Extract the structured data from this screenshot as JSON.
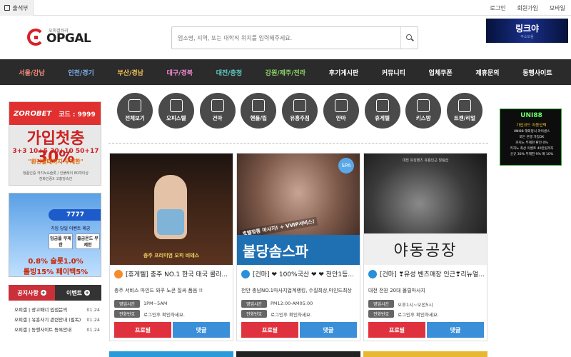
{
  "topbar": {
    "attend_label": "출석부",
    "links": [
      "로그인",
      "회원가입",
      "모바일"
    ]
  },
  "header": {
    "logo_sub": "오피갤러리",
    "logo_text": "OPGAL",
    "search_placeholder": "업소명, 지역, 또는 대학직 위치를 입력해주세요.",
    "banner_main": "링크야",
    "banner_sub": "주소모음"
  },
  "nav": {
    "items": [
      {
        "label": "서울/강남",
        "color": "#f48b7c"
      },
      {
        "label": "인천/경기",
        "color": "#7fb0f0"
      },
      {
        "label": "부산/경남",
        "color": "#f6c45a"
      },
      {
        "label": "대구/경북",
        "color": "#f48bd4"
      },
      {
        "label": "대전/충청",
        "color": "#5fd0c8"
      },
      {
        "label": "강원/제주/전라",
        "color": "#8fd86a"
      },
      {
        "label": "후기게시판",
        "color": "#ffffff"
      },
      {
        "label": "커뮤니티",
        "color": "#ffffff"
      },
      {
        "label": "업체쿠폰",
        "color": "#ffffff"
      },
      {
        "label": "제휴문의",
        "color": "#ffffff"
      },
      {
        "label": "동행사이트",
        "color": "#ffffff"
      }
    ]
  },
  "left_banner1": {
    "brand": "ZOROBET",
    "code": "코드 : 9999",
    "headline": "가입첫충 30%",
    "rates": "3+3 10+5 30+10 50+17",
    "sub": "\"환전할때까지 무제한\"",
    "foot1": "정품인증 카지노&슬롯 / 인플레이 80개이상",
    "foot2": "전화인증X 고충당속인"
  },
  "left_banner2": {
    "pill": "7777",
    "text": "가입 당일 이벤트 제공",
    "box1": "입금플 무제한",
    "box2": "출금온드 무제한",
    "line1": "0.8% 슬롯1.0%",
    "line2": "롤빙15% 페이백5%"
  },
  "notice": {
    "tab1": "공지사항",
    "tab2": "이벤트",
    "items": [
      {
        "title": "오피갤 | 광고배너 입점문의",
        "date": "01.24"
      },
      {
        "title": "오피갤 | 유흥사기 관련안내 (필독)",
        "date": "01.24"
      },
      {
        "title": "오피갤 | 동행사이트 등록안내",
        "date": "01.24"
      }
    ]
  },
  "categories": [
    "전체보기",
    "오피스텔",
    "건마",
    "핸플/립",
    "유흥주점",
    "안마",
    "휴게텔",
    "키스방",
    "트젠/리얼"
  ],
  "cards": [
    {
      "title": "[휴게텔] 충주 NO.1 한국 태국 콜라...",
      "desc": "충주 서비스 마인드 와꾸 노콘 질싸 품음 !!",
      "hours_label": "영업시간",
      "hours": "1PM~5AM",
      "phone_label": "전화번호",
      "phone": "로그인후 확인하세요.",
      "img_caption": "충주 프리미엄 오피 비테스",
      "icon_color": "#f58b2a",
      "btn1": "프로필",
      "btn2": "댓글"
    },
    {
      "title": "[건마] ❤ 100%국산 ❤ ❤ 천안1등...",
      "desc": "천안 충남NO.1마사지업계랭킹, 수질최상,마인드최상",
      "hours_label": "영업시간",
      "hours": "PM12:00-AM05:00",
      "phone_label": "전화번호",
      "phone": "로그인후 확인하세요.",
      "img_top": "호텔정통 마사지! + VVIP서비스!",
      "img_main": "불당솜스파",
      "img_badge": "SPA",
      "icon_color": "#2a8fd8",
      "btn1": "프로필",
      "btn2": "댓글"
    },
    {
      "title": "[건마] ❣유성 벤츠매장 인근❣리뉴얼...",
      "desc": "대전 전원 20대 몰릴마사지",
      "hours_label": "영업시간",
      "hours": "오후1시~오전5시",
      "phone_label": "전화번호",
      "phone": "로그인후 확인하세요.",
      "img_caption": "대전 유성벤츠 유흥인근 힐링샵",
      "img_main": "야동공장",
      "icon_color": "#2a8fd8",
      "btn1": "프로필",
      "btn2": "댓글"
    }
  ],
  "right_banner": {
    "title": "UNI88",
    "code": "가입코드 자동입력",
    "lines": [
      "UNI88 해외정식 라이센스",
      "모든 은행 가입OK",
      "카지노 무제한 환전 0%",
      "키지노 최상 이벤트 40만원까지",
      "신규 30% 무제한 9% 매 10%"
    ]
  }
}
